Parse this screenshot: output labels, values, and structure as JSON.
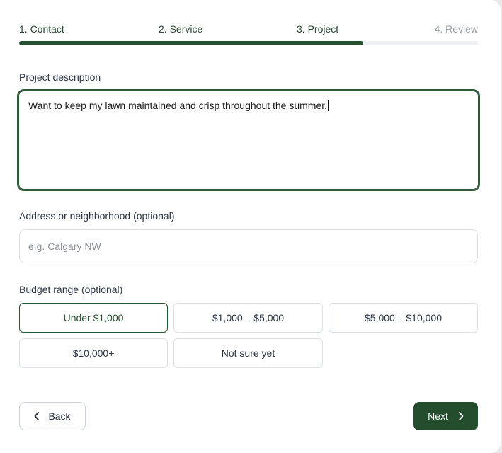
{
  "steps": {
    "items": [
      {
        "label": "1. Contact",
        "state": "completed"
      },
      {
        "label": "2. Service",
        "state": "completed"
      },
      {
        "label": "3. Project",
        "state": "current"
      },
      {
        "label": "4. Review",
        "state": "upcoming"
      }
    ],
    "progress_percent": 75
  },
  "project_description": {
    "label": "Project description",
    "value": "Want to keep my lawn maintained and crisp throughout the summer."
  },
  "address": {
    "label": "Address or neighborhood (optional)",
    "placeholder": "e.g. Calgary NW",
    "value": ""
  },
  "budget": {
    "label": "Budget range (optional)",
    "options": [
      "Under $1,000",
      "$1,000 – $5,000",
      "$5,000 – $10,000",
      "$10,000+",
      "Not sure yet"
    ],
    "selected": "Under $1,000"
  },
  "actions": {
    "back_label": "Back",
    "next_label": "Next"
  },
  "icons": {
    "back": "chevron-left-icon",
    "next": "chevron-right-icon"
  },
  "colors": {
    "accent": "#234d2c",
    "track": "#eef0f4",
    "upcoming_step": "#9aa0a6"
  }
}
